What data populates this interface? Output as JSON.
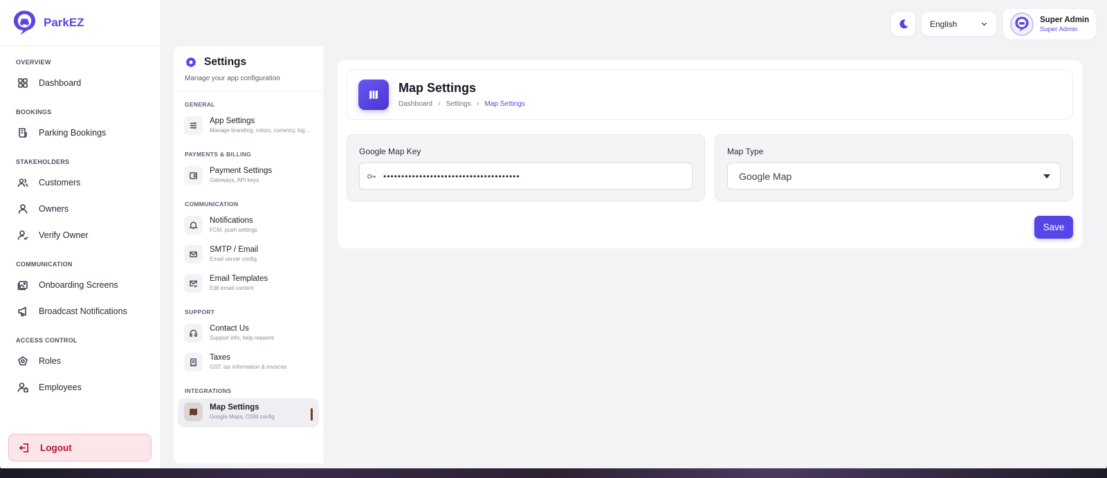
{
  "brand": {
    "name": "ParkEZ"
  },
  "sidebar": {
    "sections": [
      {
        "title": "OVERVIEW",
        "items": [
          {
            "label": "Dashboard",
            "icon": "grid-icon"
          }
        ]
      },
      {
        "title": "BOOKINGS",
        "items": [
          {
            "label": "Parking Bookings",
            "icon": "receipt-icon"
          }
        ]
      },
      {
        "title": "STAKEHOLDERS",
        "items": [
          {
            "label": "Customers",
            "icon": "users-icon"
          },
          {
            "label": "Owners",
            "icon": "user-icon"
          },
          {
            "label": "Verify Owner",
            "icon": "user-check-icon"
          }
        ]
      },
      {
        "title": "COMMUNICATION",
        "items": [
          {
            "label": "Onboarding Screens",
            "icon": "images-icon"
          },
          {
            "label": "Broadcast Notifications",
            "icon": "megaphone-icon"
          }
        ]
      },
      {
        "title": "ACCESS CONTROL",
        "items": [
          {
            "label": "Roles",
            "icon": "roles-icon"
          },
          {
            "label": "Employees",
            "icon": "employee-icon"
          }
        ]
      }
    ],
    "logout_label": "Logout"
  },
  "topbar": {
    "language": "English",
    "user_name": "Super Admin",
    "user_role": "Super Admin"
  },
  "settings_panel": {
    "title": "Settings",
    "subtitle": "Manage your app configuration",
    "groups": [
      {
        "title": "GENERAL",
        "items": [
          {
            "label": "App Settings",
            "desc": "Manage branding, colors, currency, logo & more"
          }
        ]
      },
      {
        "title": "PAYMENTS & BILLING",
        "items": [
          {
            "label": "Payment Settings",
            "desc": "Gateways, API keys"
          }
        ]
      },
      {
        "title": "COMMUNICATION",
        "items": [
          {
            "label": "Notifications",
            "desc": "FCM, push settings"
          },
          {
            "label": "SMTP / Email",
            "desc": "Email server config"
          },
          {
            "label": "Email Templates",
            "desc": "Edit email content"
          }
        ]
      },
      {
        "title": "SUPPORT",
        "items": [
          {
            "label": "Contact Us",
            "desc": "Support info, help reasons"
          },
          {
            "label": "Taxes",
            "desc": "GST, tax information & invoices"
          }
        ]
      },
      {
        "title": "INTEGRATIONS",
        "items": [
          {
            "label": "Map Settings",
            "desc": "Google Maps, OSM config"
          }
        ]
      }
    ]
  },
  "main": {
    "title": "Map Settings",
    "breadcrumb": [
      "Dashboard",
      "Settings",
      "Map Settings"
    ],
    "google_map_key_label": "Google Map Key",
    "google_map_key_value": "••••••••••••••••••••••••••••••••••••••",
    "map_type_label": "Map Type",
    "map_type_value": "Google Map",
    "save_label": "Save"
  },
  "colors": {
    "accent": "#5746e6",
    "logout_bg": "#fde6e9",
    "logout_text": "#b0182e"
  }
}
